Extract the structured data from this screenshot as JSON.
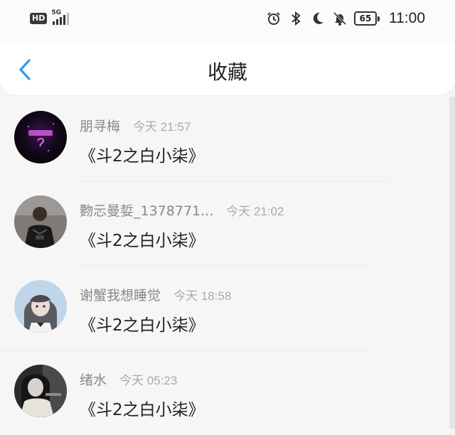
{
  "status_bar": {
    "hd": "HD",
    "network": "5G",
    "battery": "65",
    "time": "11:00"
  },
  "header": {
    "title": "收藏",
    "back_icon": "chevron-left-icon",
    "accent": "#2d9bf0"
  },
  "favorites": [
    {
      "name": "朋寻梅",
      "time": "今天 21:57",
      "message": "《斗2之白小柒》"
    },
    {
      "name": "覅忈曼娎_1378771...",
      "time": "今天 21:02",
      "message": "《斗2之白小柒》"
    },
    {
      "name": "谢蟹我想睡觉",
      "time": "今天 18:58",
      "message": "《斗2之白小柒》"
    },
    {
      "name": "绪水",
      "time": "今天 05:23",
      "message": "《斗2之白小柒》"
    }
  ]
}
